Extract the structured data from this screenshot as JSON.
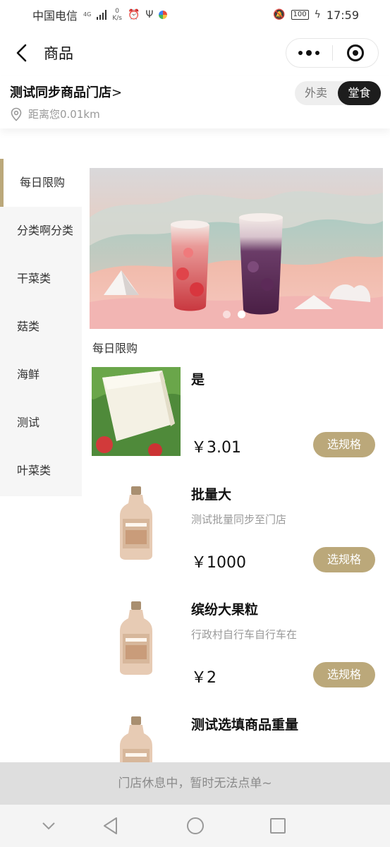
{
  "status_bar": {
    "carrier": "中国电信",
    "network": "4G",
    "speed_value": "0",
    "speed_unit": "K/s",
    "battery": "100",
    "time": "17:59"
  },
  "nav": {
    "title": "商品"
  },
  "store": {
    "name": "测试同步商品门店",
    "name_arrow": ">",
    "distance": "距离您0.01km",
    "modes": [
      "外卖",
      "堂食"
    ],
    "active_mode": "堂食"
  },
  "categories": [
    {
      "label": "每日限购",
      "active": true
    },
    {
      "label": "分类啊分类",
      "active": false
    },
    {
      "label": "干菜类",
      "active": false
    },
    {
      "label": "菇类",
      "active": false
    },
    {
      "label": "海鲜",
      "active": false
    },
    {
      "label": "测试",
      "active": false
    },
    {
      "label": "叶菜类",
      "active": false
    }
  ],
  "banner": {
    "slides": 2,
    "active_slide": 2
  },
  "section_title": "每日限购",
  "products": [
    {
      "name": "是",
      "desc": "",
      "price": "￥3.01",
      "button": "选规格",
      "image": "tofu"
    },
    {
      "name": "批量大",
      "desc": "测试批量同步至门店",
      "price": "￥1000",
      "button": "选规格",
      "image": "bottle"
    },
    {
      "name": "缤纷大果粒",
      "desc": "行政村自行车自行车在",
      "price": "￥2",
      "button": "选规格",
      "image": "bottle"
    },
    {
      "name": "测试选填商品重量",
      "desc": "",
      "price": "",
      "button": "",
      "image": "bottle"
    }
  ],
  "closed_notice": "门店休息中，暂时无法点单~",
  "colors": {
    "accent": "#bba87a",
    "dark": "#1d1d1d",
    "notice_bg": "#dedede"
  }
}
